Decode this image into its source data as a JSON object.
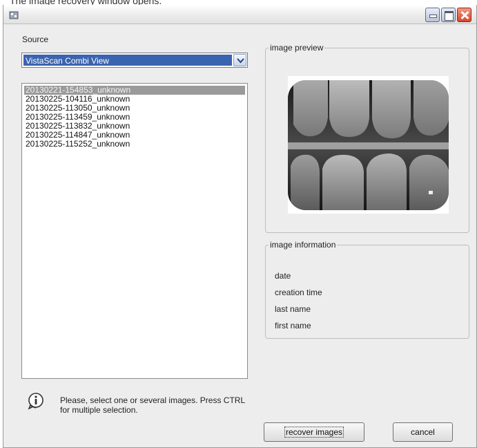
{
  "caption": "The image recovery window opens.",
  "window": {
    "title": ""
  },
  "source": {
    "label": "Source",
    "selected": "VistaScan Combi View"
  },
  "images": {
    "items": [
      "20130221-154853_unknown",
      "20130225-104116_unknown",
      "20130225-113050_unknown",
      "20130225-113459_unknown",
      "20130225-113832_unknown",
      "20130225-114847_unknown",
      "20130225-115252_unknown"
    ],
    "selected_index": 0
  },
  "preview": {
    "label": "image preview"
  },
  "info": {
    "label": "image information",
    "fields": [
      "date",
      "creation time",
      "last name",
      "first name"
    ]
  },
  "hint": {
    "icon": "info-icon",
    "text": "Please, select one or several images. Press CTRL for multiple selection."
  },
  "buttons": {
    "recover": "recover images",
    "cancel": "cancel"
  },
  "colors": {
    "selection": "#3b64b0",
    "close_button": "#d8452a",
    "window_bg": "#ededed"
  }
}
